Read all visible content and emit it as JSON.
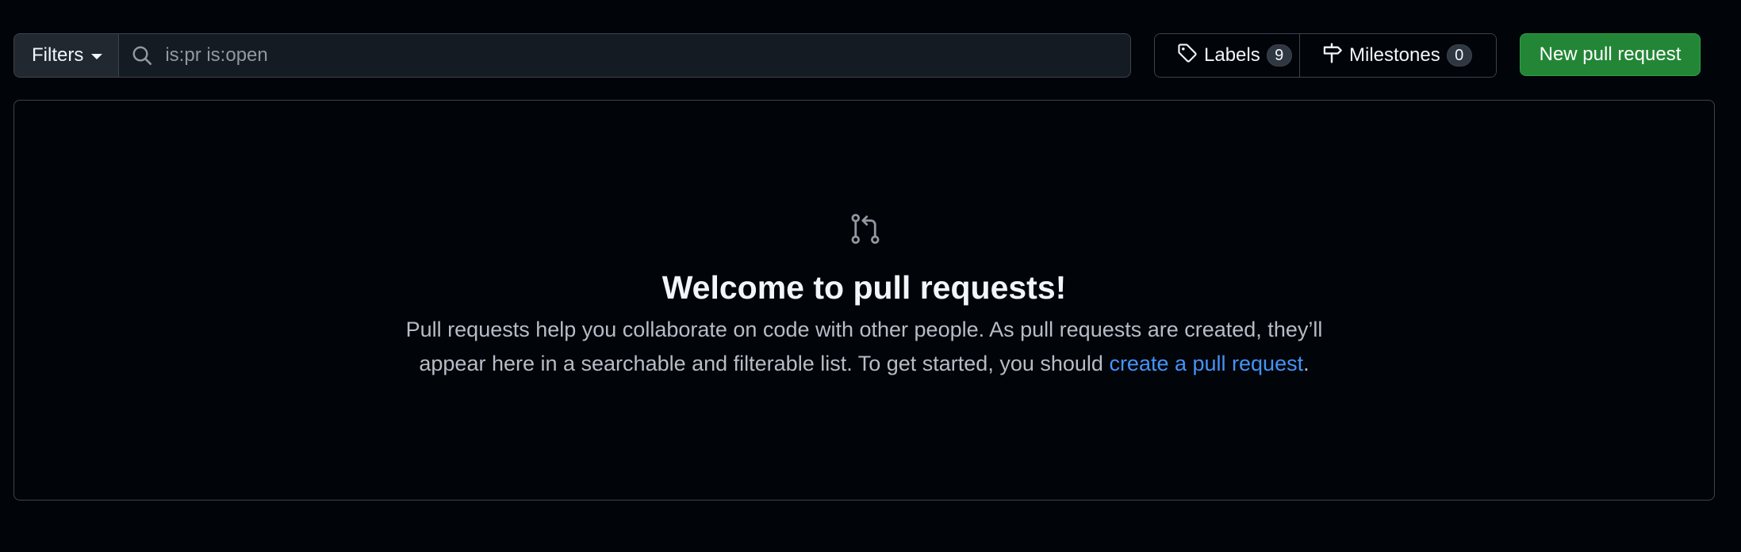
{
  "toolbar": {
    "filters_label": "Filters",
    "search_value": "is:pr is:open",
    "labels_label": "Labels",
    "labels_count": "9",
    "milestones_label": "Milestones",
    "milestones_count": "0",
    "new_pr_label": "New pull request"
  },
  "blankslate": {
    "title": "Welcome to pull requests!",
    "desc_line1": "Pull requests help you collaborate on code with other people. As pull requests are created, they’ll",
    "desc_line2_prefix": "appear here in a searchable and filterable list. To get started, you should ",
    "link_text": "create a pull request",
    "desc_suffix": "."
  },
  "icons": {
    "search": "search-icon",
    "tag": "tag-icon",
    "milestone": "milestone-icon",
    "pull_request": "git-pull-request-icon",
    "caret": "triangle-down-icon"
  },
  "colors": {
    "background": "#010409",
    "border": "#3d444d",
    "primary_button": "#238636",
    "link": "#4493f8",
    "muted_text": "#9198a1"
  }
}
